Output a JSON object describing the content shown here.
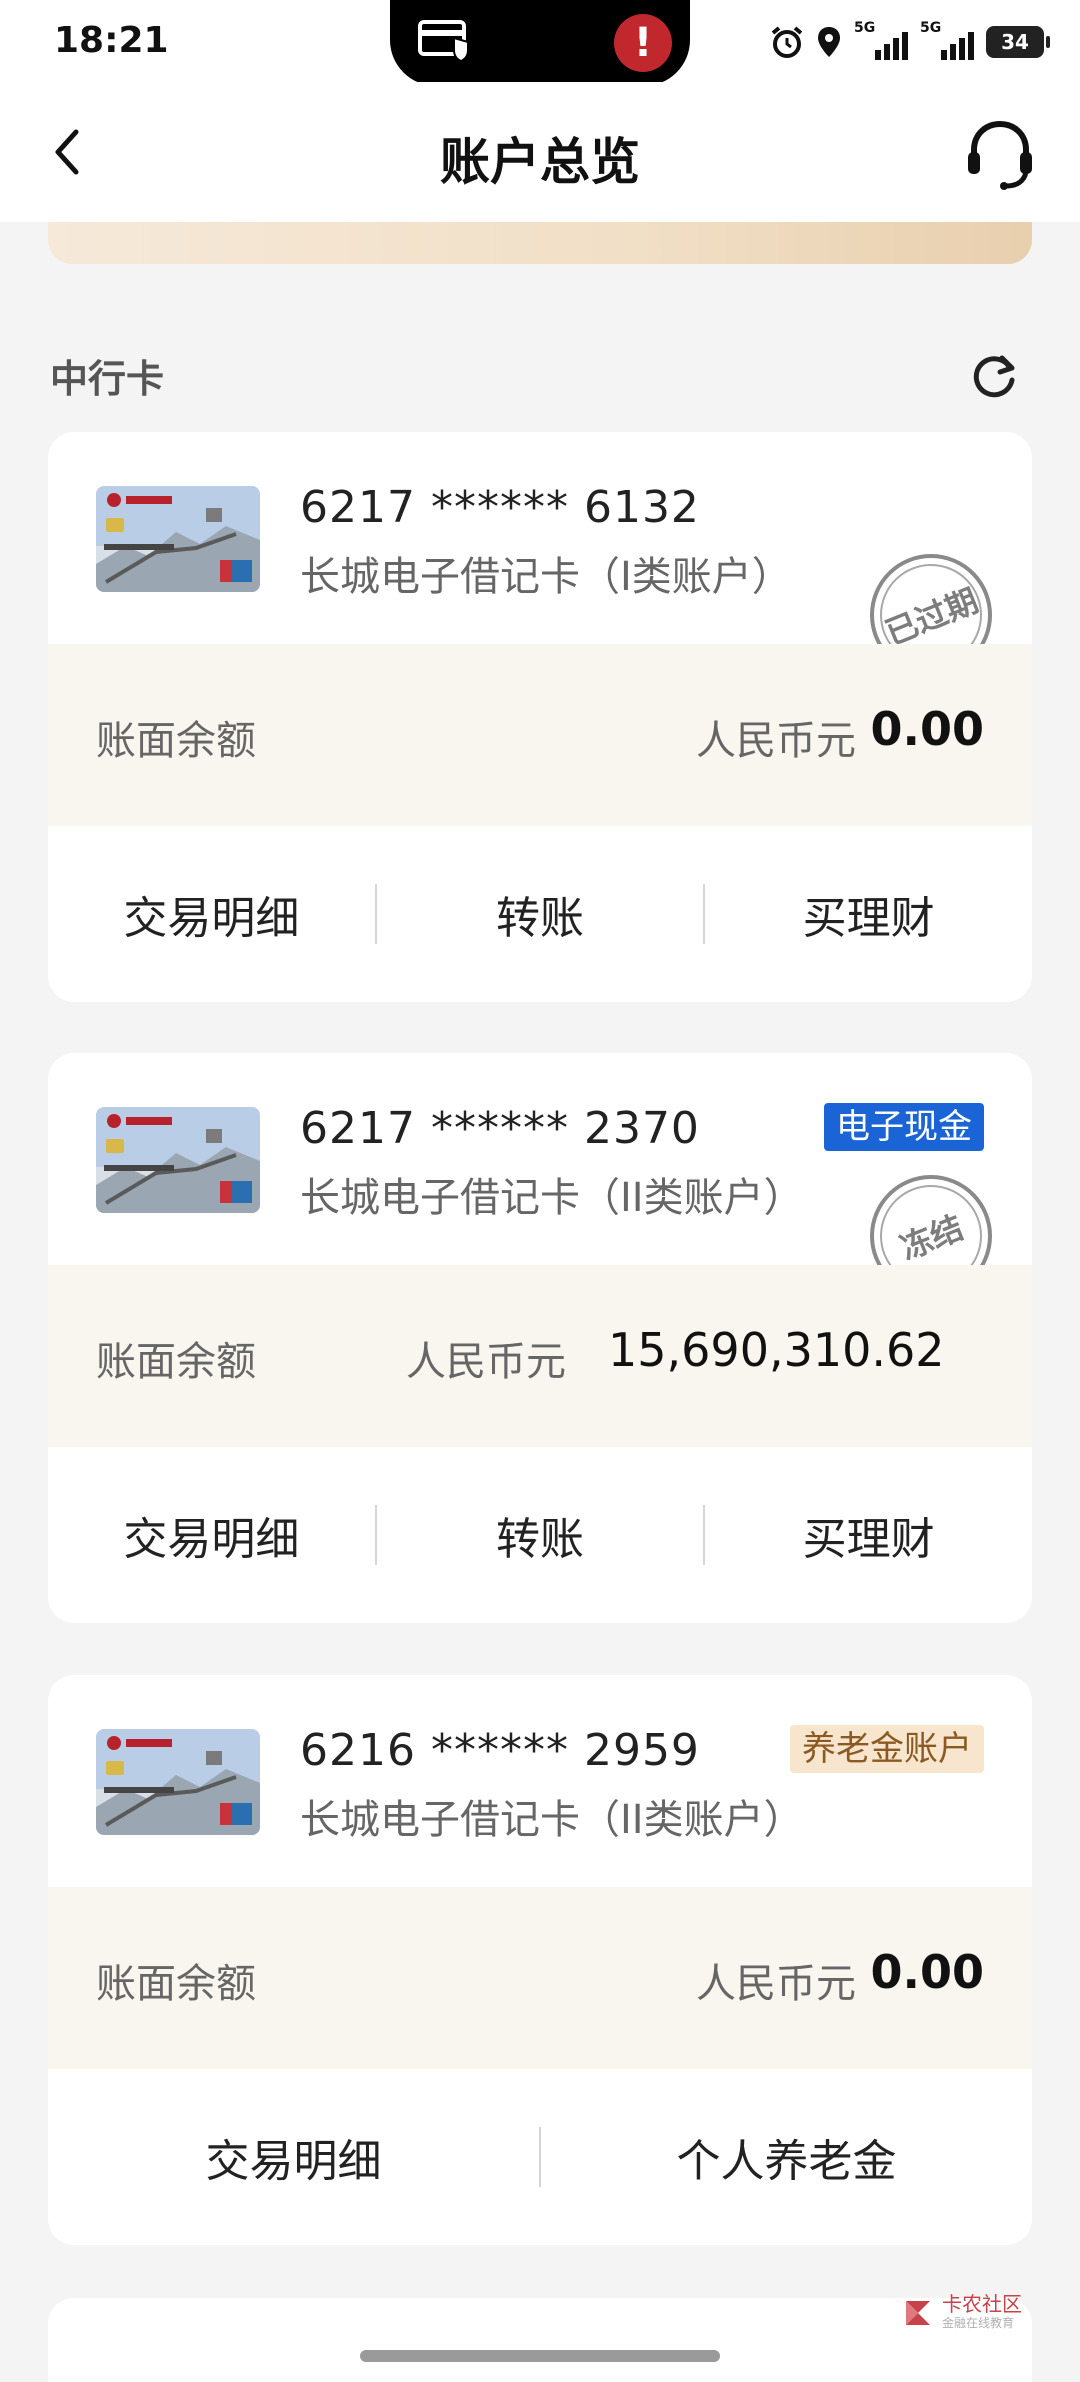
{
  "status_bar": {
    "time": "18:21",
    "battery": "34",
    "signal_1": "5G",
    "signal_2": "5G"
  },
  "nav": {
    "title": "账户总览"
  },
  "section": {
    "title": "中行卡"
  },
  "cards": [
    {
      "number": "6217 ****** 6132",
      "type": "长城电子借记卡（I类账户）",
      "stamp": "已过期",
      "balance_label": "账面余额",
      "currency": "人民币元",
      "amount": "0.00",
      "actions": [
        "交易明细",
        "转账",
        "买理财"
      ]
    },
    {
      "number": "6217 ****** 2370",
      "type": "长城电子借记卡（II类账户）",
      "badge": "电子现金",
      "stamp": "冻结",
      "balance_label": "账面余额",
      "currency": "人民币元",
      "amount": "15,690,310.62",
      "actions": [
        "交易明细",
        "转账",
        "买理财"
      ]
    },
    {
      "number": "6216 ****** 2959",
      "type": "长城电子借记卡（II类账户）",
      "badge": "养老金账户",
      "balance_label": "账面余额",
      "currency": "人民币元",
      "amount": "0.00",
      "actions": [
        "交易明细",
        "个人养老金"
      ]
    }
  ],
  "watermark": {
    "title": "卡农社区",
    "subtitle": "金融在线教育"
  },
  "colors": {
    "accent_blue": "#1a64d6",
    "pension_badge_bg": "#f7e5cd",
    "balance_row_bg": "#f9f5ef",
    "banner_gold": "#e8cfae"
  },
  "icons": {
    "back": "chevron-left-icon",
    "service": "headset-icon",
    "refresh": "refresh-icon"
  }
}
